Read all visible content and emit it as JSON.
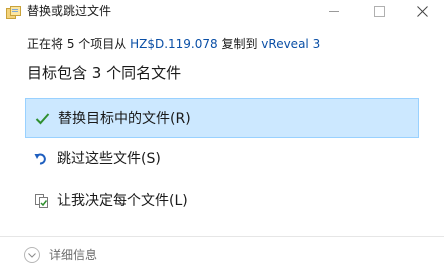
{
  "window": {
    "title": "替换或跳过文件",
    "app_icon": "copy-files-icon",
    "controls": [
      "minimize-icon",
      "maximize-icon",
      "close-icon"
    ]
  },
  "copy_status": {
    "prefix": "正在将 5 个项目从 ",
    "source": "HZ$D.119.078",
    "middle": " 复制到 ",
    "destination": "vReveal 3"
  },
  "heading": "目标包含 3 个同名文件",
  "options": [
    {
      "label": "替换目标中的文件(R)",
      "icon": "checkmark-icon",
      "selected": true
    },
    {
      "label": "跳过这些文件(S)",
      "icon": "skip-arrow-icon",
      "selected": false
    },
    {
      "label": "让我决定每个文件(L)",
      "icon": "decide-files-icon",
      "selected": false
    }
  ],
  "footer": {
    "details_label": "详细信息",
    "details_icon": "chevron-down-icon"
  },
  "colors": {
    "selected_bg": "#cce8ff",
    "selected_border": "#99d1ff",
    "link": "#0a4fa6",
    "check": "#2f8f2f",
    "skip_icon": "#1f5fbf"
  }
}
